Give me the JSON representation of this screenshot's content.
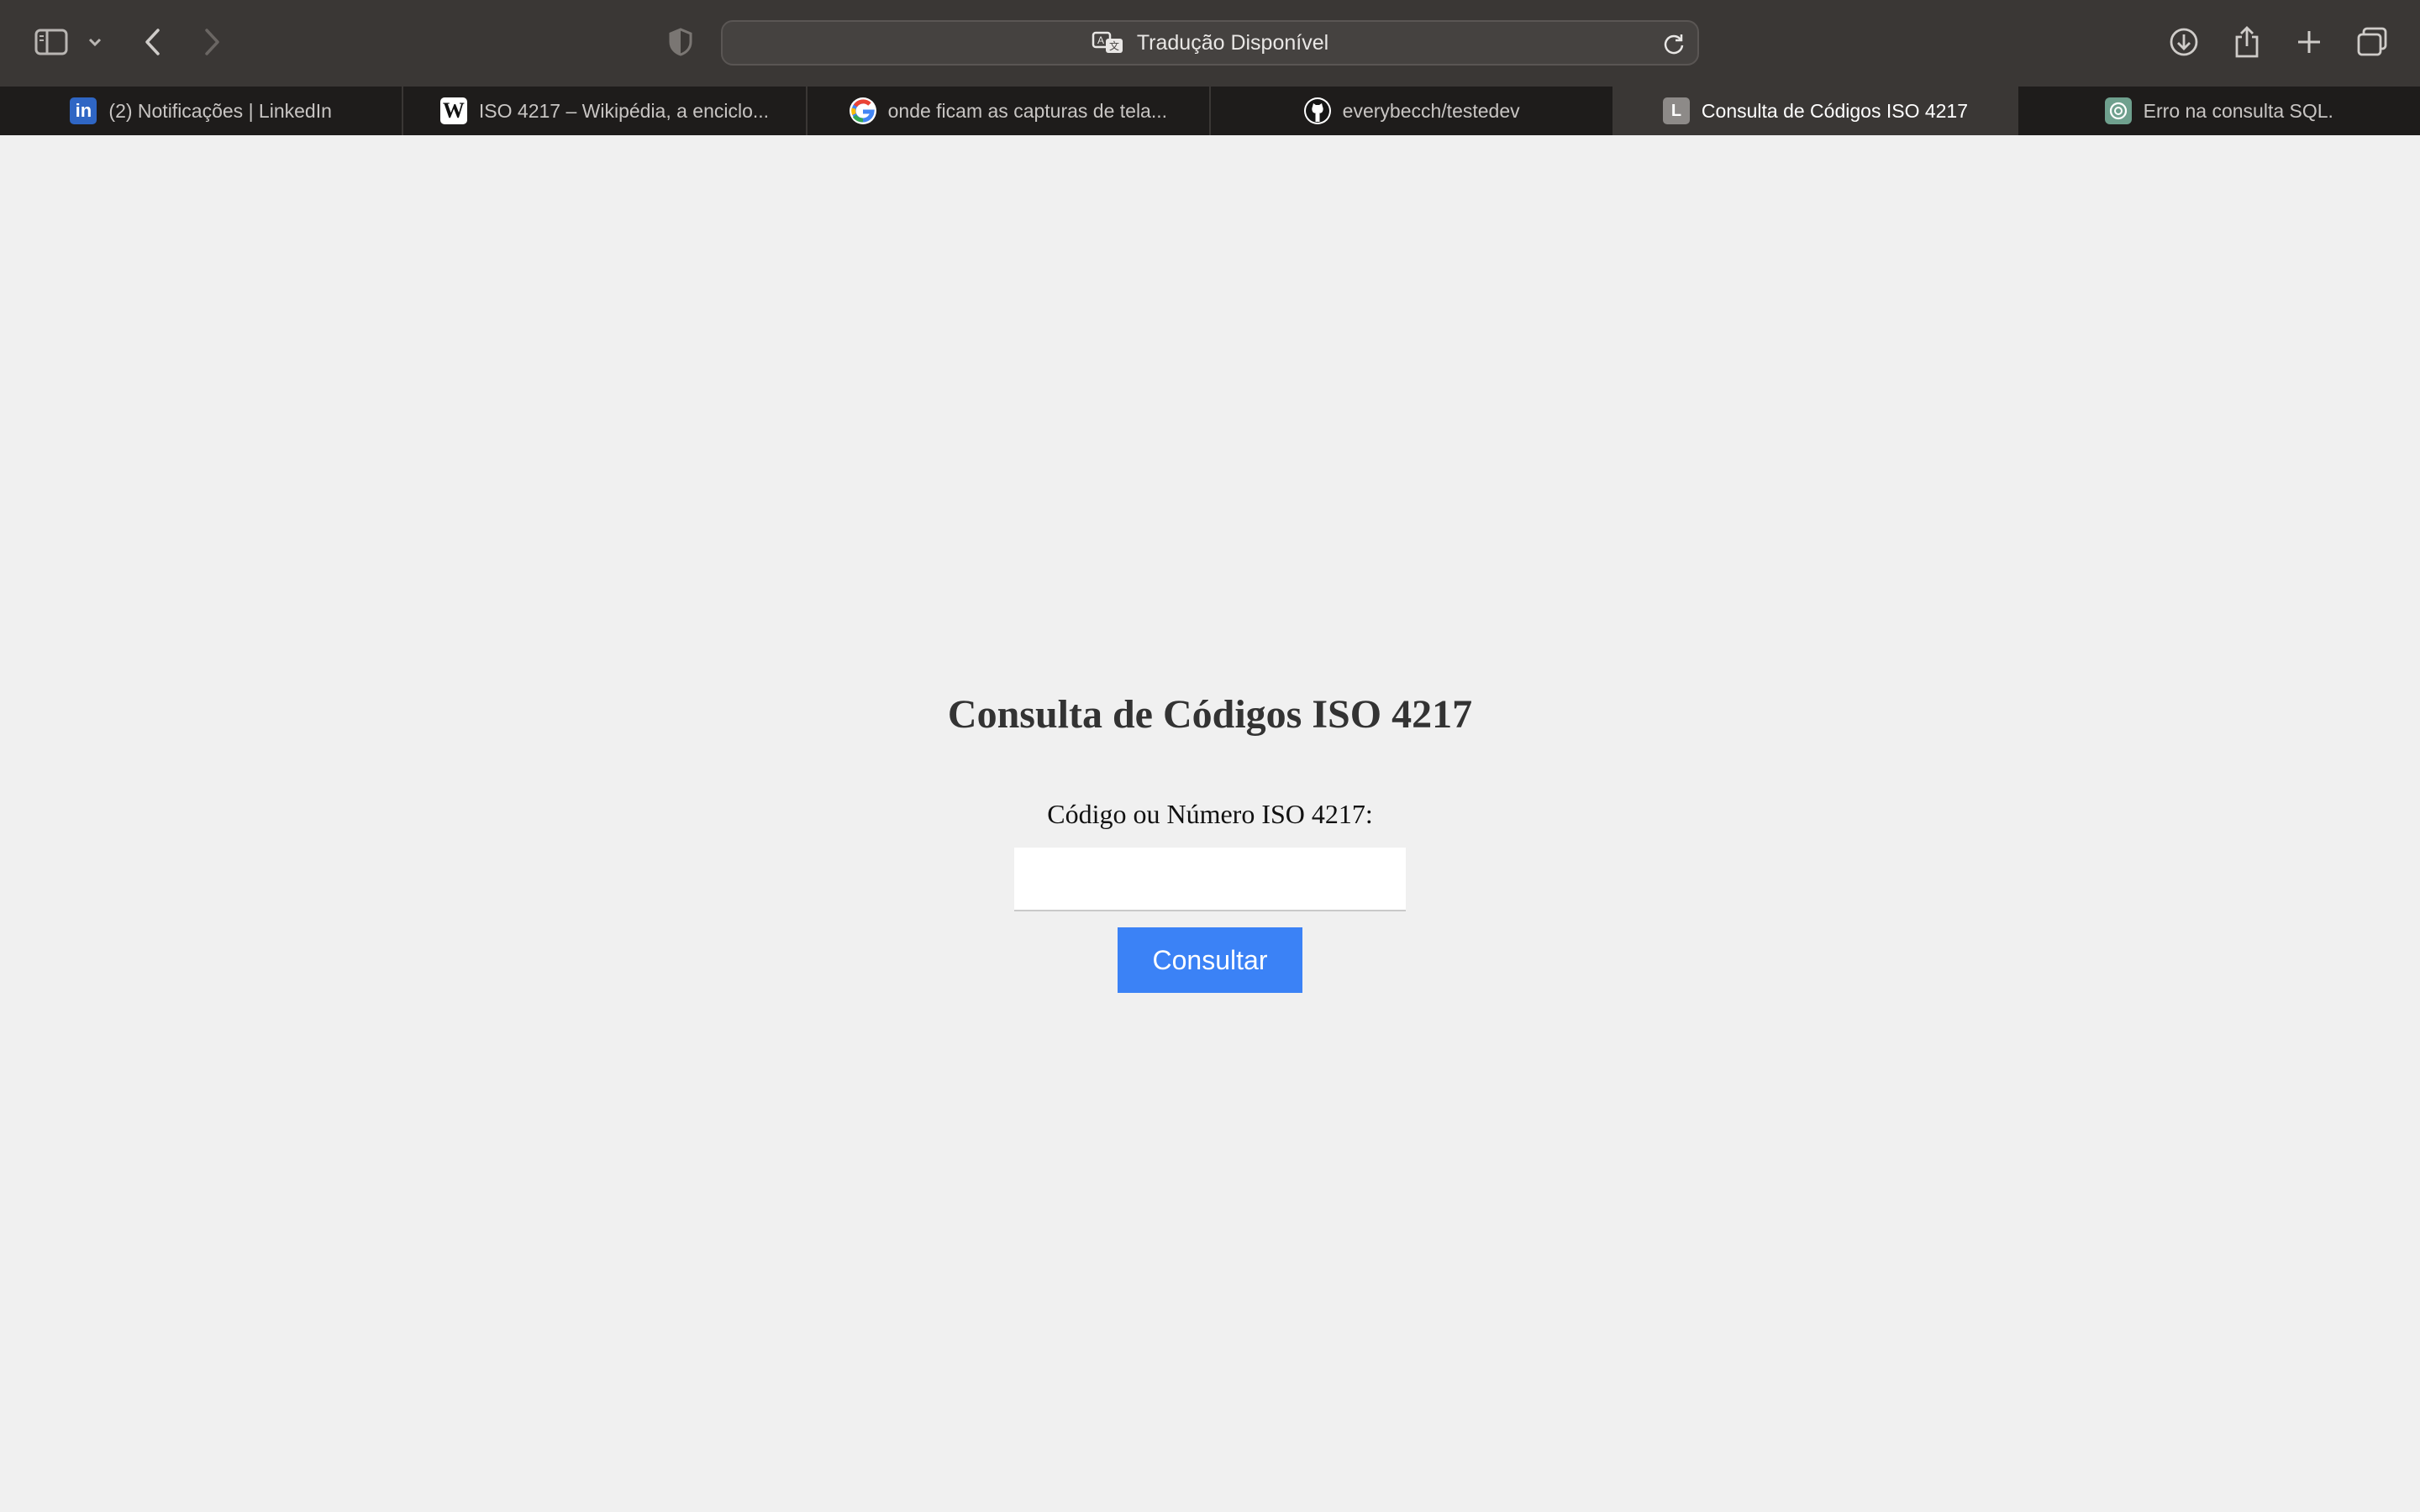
{
  "browser": {
    "address_bar": {
      "text": "Tradução Disponível"
    },
    "toolbar_icons": [
      "sidebar-icon",
      "chevron-down-icon",
      "back-icon",
      "forward-icon",
      "privacy-shield-icon",
      "translate-icon",
      "reload-icon",
      "download-icon",
      "share-icon",
      "plus-icon",
      "tabs-overview-icon"
    ],
    "tabs": [
      {
        "label": "(2) Notificações | LinkedIn",
        "favicon": "in",
        "active": false
      },
      {
        "label": "ISO 4217 – Wikipédia, a enciclo...",
        "favicon": "W",
        "active": false
      },
      {
        "label": "onde ficam as capturas de tela...",
        "favicon": "G",
        "active": false
      },
      {
        "label": "everybecch/testedev",
        "favicon": "github",
        "active": false
      },
      {
        "label": "Consulta de Códigos ISO 4217",
        "favicon": "L",
        "active": true
      },
      {
        "label": "Erro na consulta SQL.",
        "favicon": "chatgpt",
        "active": false
      }
    ]
  },
  "page": {
    "title": "Consulta de Códigos ISO 4217",
    "field_label": "Código ou Número ISO 4217:",
    "input_value": "",
    "submit_label": "Consultar"
  },
  "colors": {
    "toolbar_bg": "#3a3735",
    "tabbar_bg": "#1e1c1b",
    "page_bg": "#f0f0f0",
    "button_bg": "#3b82f6"
  }
}
